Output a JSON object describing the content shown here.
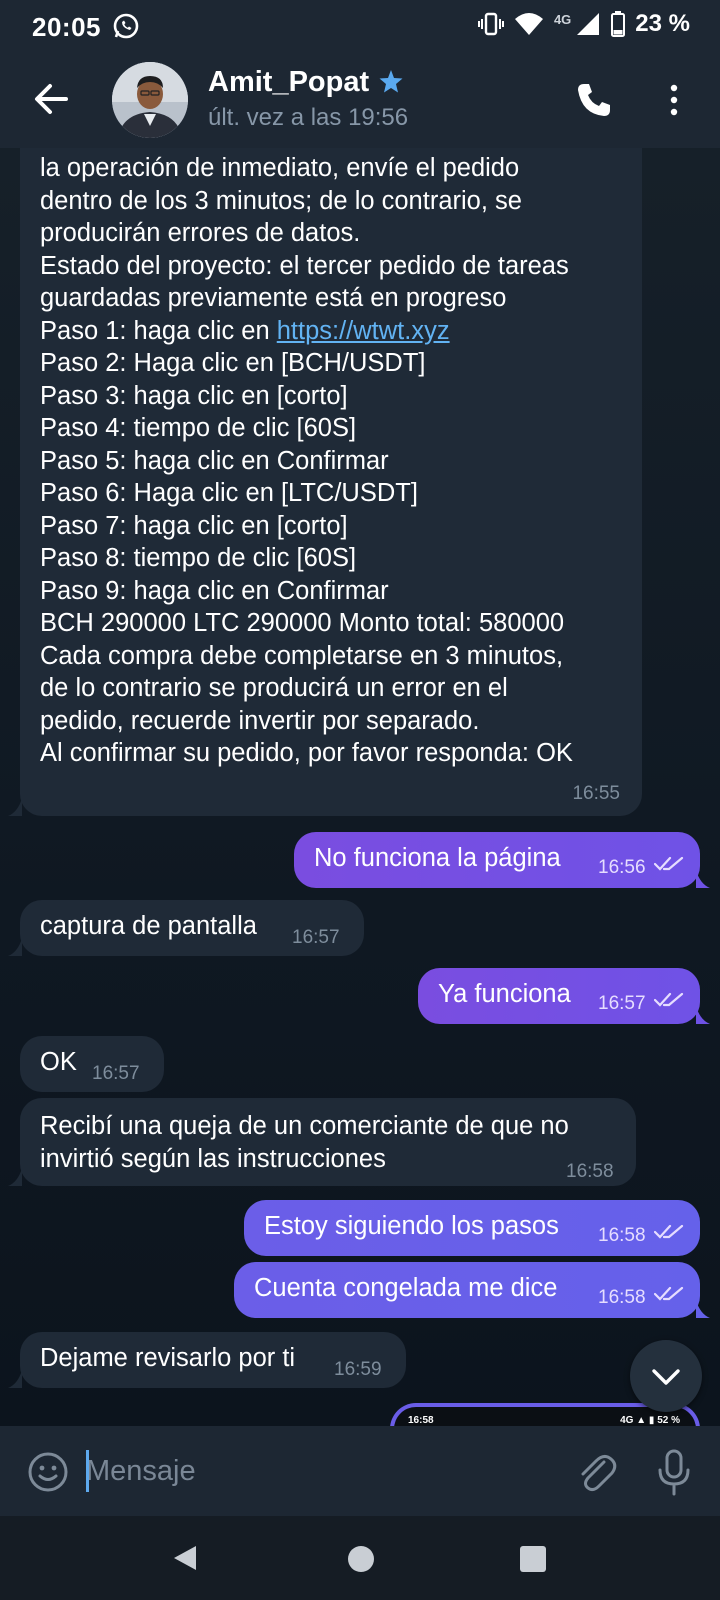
{
  "status_bar": {
    "time": "20:05",
    "network": "4G",
    "battery": "23 %"
  },
  "header": {
    "contact_name": "Amit_Popat",
    "last_seen": "últ. vez a las 19:56",
    "verified_icon": "star-icon",
    "icons": [
      "back-arrow-icon",
      "phone-icon",
      "more-vertical-icon"
    ]
  },
  "messages": [
    {
      "direction": "in",
      "lines": [
        "la operación de inmediato, envíe el pedido",
        "dentro de los 3 minutos; de lo contrario, se",
        "producirán errores de datos.",
        "Estado del proyecto: el tercer pedido de tareas",
        "guardadas previamente está en progreso",
        "Paso 1: haga clic en ",
        "Paso 2: Haga clic en [BCH/USDT]",
        "Paso 3: haga clic en [corto]",
        "Paso 4: tiempo de clic [60S]",
        "Paso 5: haga clic en Confirmar",
        "Paso 6: Haga clic en [LTC/USDT]",
        "Paso 7: haga clic en [corto]",
        "Paso 8: tiempo de clic [60S]",
        "Paso 9: haga clic en Confirmar",
        "BCH 290000 LTC 290000 Monto total: 580000",
        "Cada compra debe completarse en 3 minutos,",
        "de lo contrario se producirá un error en el",
        "pedido, recuerde invertir por separado.",
        "Al confirmar su pedido, por favor responda: OK"
      ],
      "link": "https://wtwt.xyz",
      "time": "16:55"
    },
    {
      "direction": "out",
      "text": "No funciona la página",
      "time": "16:56"
    },
    {
      "direction": "in",
      "text": "captura de pantalla",
      "time": "16:57"
    },
    {
      "direction": "out",
      "text": "Ya funciona",
      "time": "16:57"
    },
    {
      "direction": "in",
      "text": "OK",
      "time": "16:57"
    },
    {
      "direction": "in",
      "lines": [
        "Recibí una queja de un comerciante de que no",
        "invirtió según las instrucciones"
      ],
      "time": "16:58"
    },
    {
      "direction": "out",
      "text": "Estoy siguiendo los pasos",
      "time": "16:58"
    },
    {
      "direction": "out",
      "text": "Cuenta congelada me dice",
      "time": "16:58"
    },
    {
      "direction": "in",
      "text": "Dejame revisarlo por ti",
      "time": "16:59"
    }
  ],
  "preview": {
    "time": "16:58",
    "status": "4G ▲ ▮ 52 %"
  },
  "composer": {
    "placeholder": "Mensaje",
    "value": ""
  },
  "colors": {
    "background": "#0f1823",
    "header": "#1d2733",
    "incoming_bubble": "#1f2a37",
    "outgoing_bubble": "#7a4de0",
    "link": "#62b3f3",
    "accent": "#5ea9ee"
  }
}
